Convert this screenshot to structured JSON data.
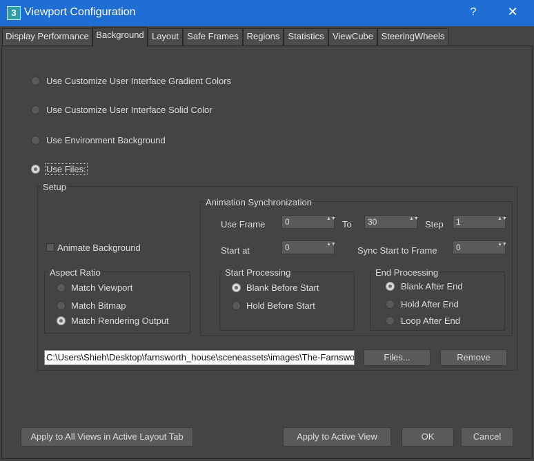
{
  "window": {
    "title": "Viewport Configuration",
    "app_icon": "3",
    "help_glyph": "?",
    "close_glyph": "✕"
  },
  "tabs": [
    {
      "label": "Display Performance"
    },
    {
      "label": "Background"
    },
    {
      "label": "Layout"
    },
    {
      "label": "Safe Frames"
    },
    {
      "label": "Regions"
    },
    {
      "label": "Statistics"
    },
    {
      "label": "ViewCube"
    },
    {
      "label": "SteeringWheels"
    }
  ],
  "active_tab": "Background",
  "background_options": [
    {
      "label": "Use Customize User Interface Gradient Colors",
      "selected": false
    },
    {
      "label": "Use Customize User Interface Solid Color",
      "selected": false
    },
    {
      "label": "Use Environment Background",
      "selected": false
    },
    {
      "label": "Use Files:",
      "selected": true
    }
  ],
  "setup": {
    "title": "Setup",
    "animate_background": {
      "label": "Animate Background",
      "checked": false
    },
    "aspect_ratio": {
      "title": "Aspect Ratio",
      "options": [
        {
          "label": "Match Viewport",
          "selected": false
        },
        {
          "label": "Match Bitmap",
          "selected": false
        },
        {
          "label": "Match Rendering Output",
          "selected": true
        }
      ]
    },
    "animation_sync": {
      "title": "Animation Synchronization",
      "use_frame_label": "Use Frame",
      "use_frame_value": "0",
      "to_label": "To",
      "to_value": "30",
      "step_label": "Step",
      "step_value": "1",
      "start_at_label": "Start at",
      "start_at_value": "0",
      "sync_start_label": "Sync Start to Frame",
      "sync_start_value": "0",
      "start_processing": {
        "title": "Start Processing",
        "options": [
          {
            "label": "Blank Before Start",
            "selected": true
          },
          {
            "label": "Hold Before Start",
            "selected": false
          }
        ]
      },
      "end_processing": {
        "title": "End Processing",
        "options": [
          {
            "label": "Blank After End",
            "selected": true
          },
          {
            "label": "Hold After End",
            "selected": false
          },
          {
            "label": "Loop After End",
            "selected": false
          }
        ]
      }
    },
    "file_path": "C:\\Users\\Shieh\\Desktop\\farnsworth_house\\sceneassets\\images\\The-Farnswo",
    "files_button": "Files...",
    "remove_button": "Remove"
  },
  "footer": {
    "apply_all": "Apply to All Views in Active Layout Tab",
    "apply_active": "Apply to Active View",
    "ok": "OK",
    "cancel": "Cancel"
  },
  "spinner_arrows": "▲▼"
}
